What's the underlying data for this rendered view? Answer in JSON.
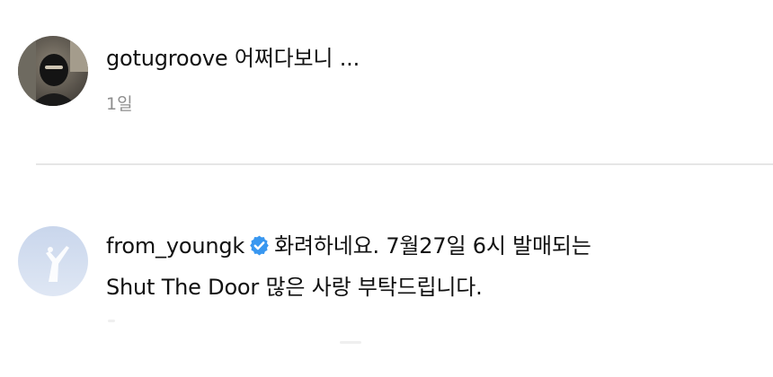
{
  "comments": [
    {
      "username": "gotugroove",
      "text": "어쩌다보니 ...",
      "time": "1일",
      "avatar": "masked-person-avatar"
    },
    {
      "username": "from_youngk",
      "verified": true,
      "text_line1": "화려하네요. 7월27일 6시 발매되는",
      "text_line2": "Shut The Door 많은 사랑 부탁드립니다.",
      "avatar": "sky-silhouette-avatar"
    }
  ],
  "colors": {
    "text": "#111111",
    "secondary": "#8e8e8e",
    "divider": "#e6e6e6",
    "verified": "#3897f0"
  }
}
